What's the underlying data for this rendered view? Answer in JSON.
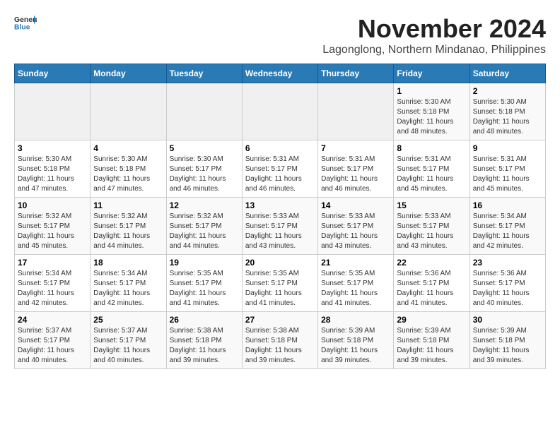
{
  "header": {
    "logo_general": "General",
    "logo_blue": "Blue",
    "month_year": "November 2024",
    "location": "Lagonglong, Northern Mindanao, Philippines"
  },
  "weekdays": [
    "Sunday",
    "Monday",
    "Tuesday",
    "Wednesday",
    "Thursday",
    "Friday",
    "Saturday"
  ],
  "weeks": [
    [
      {
        "day": "",
        "info": ""
      },
      {
        "day": "",
        "info": ""
      },
      {
        "day": "",
        "info": ""
      },
      {
        "day": "",
        "info": ""
      },
      {
        "day": "",
        "info": ""
      },
      {
        "day": "1",
        "info": "Sunrise: 5:30 AM\nSunset: 5:18 PM\nDaylight: 11 hours\nand 48 minutes."
      },
      {
        "day": "2",
        "info": "Sunrise: 5:30 AM\nSunset: 5:18 PM\nDaylight: 11 hours\nand 48 minutes."
      }
    ],
    [
      {
        "day": "3",
        "info": "Sunrise: 5:30 AM\nSunset: 5:18 PM\nDaylight: 11 hours\nand 47 minutes."
      },
      {
        "day": "4",
        "info": "Sunrise: 5:30 AM\nSunset: 5:18 PM\nDaylight: 11 hours\nand 47 minutes."
      },
      {
        "day": "5",
        "info": "Sunrise: 5:30 AM\nSunset: 5:17 PM\nDaylight: 11 hours\nand 46 minutes."
      },
      {
        "day": "6",
        "info": "Sunrise: 5:31 AM\nSunset: 5:17 PM\nDaylight: 11 hours\nand 46 minutes."
      },
      {
        "day": "7",
        "info": "Sunrise: 5:31 AM\nSunset: 5:17 PM\nDaylight: 11 hours\nand 46 minutes."
      },
      {
        "day": "8",
        "info": "Sunrise: 5:31 AM\nSunset: 5:17 PM\nDaylight: 11 hours\nand 45 minutes."
      },
      {
        "day": "9",
        "info": "Sunrise: 5:31 AM\nSunset: 5:17 PM\nDaylight: 11 hours\nand 45 minutes."
      }
    ],
    [
      {
        "day": "10",
        "info": "Sunrise: 5:32 AM\nSunset: 5:17 PM\nDaylight: 11 hours\nand 45 minutes."
      },
      {
        "day": "11",
        "info": "Sunrise: 5:32 AM\nSunset: 5:17 PM\nDaylight: 11 hours\nand 44 minutes."
      },
      {
        "day": "12",
        "info": "Sunrise: 5:32 AM\nSunset: 5:17 PM\nDaylight: 11 hours\nand 44 minutes."
      },
      {
        "day": "13",
        "info": "Sunrise: 5:33 AM\nSunset: 5:17 PM\nDaylight: 11 hours\nand 43 minutes."
      },
      {
        "day": "14",
        "info": "Sunrise: 5:33 AM\nSunset: 5:17 PM\nDaylight: 11 hours\nand 43 minutes."
      },
      {
        "day": "15",
        "info": "Sunrise: 5:33 AM\nSunset: 5:17 PM\nDaylight: 11 hours\nand 43 minutes."
      },
      {
        "day": "16",
        "info": "Sunrise: 5:34 AM\nSunset: 5:17 PM\nDaylight: 11 hours\nand 42 minutes."
      }
    ],
    [
      {
        "day": "17",
        "info": "Sunrise: 5:34 AM\nSunset: 5:17 PM\nDaylight: 11 hours\nand 42 minutes."
      },
      {
        "day": "18",
        "info": "Sunrise: 5:34 AM\nSunset: 5:17 PM\nDaylight: 11 hours\nand 42 minutes."
      },
      {
        "day": "19",
        "info": "Sunrise: 5:35 AM\nSunset: 5:17 PM\nDaylight: 11 hours\nand 41 minutes."
      },
      {
        "day": "20",
        "info": "Sunrise: 5:35 AM\nSunset: 5:17 PM\nDaylight: 11 hours\nand 41 minutes."
      },
      {
        "day": "21",
        "info": "Sunrise: 5:35 AM\nSunset: 5:17 PM\nDaylight: 11 hours\nand 41 minutes."
      },
      {
        "day": "22",
        "info": "Sunrise: 5:36 AM\nSunset: 5:17 PM\nDaylight: 11 hours\nand 41 minutes."
      },
      {
        "day": "23",
        "info": "Sunrise: 5:36 AM\nSunset: 5:17 PM\nDaylight: 11 hours\nand 40 minutes."
      }
    ],
    [
      {
        "day": "24",
        "info": "Sunrise: 5:37 AM\nSunset: 5:17 PM\nDaylight: 11 hours\nand 40 minutes."
      },
      {
        "day": "25",
        "info": "Sunrise: 5:37 AM\nSunset: 5:17 PM\nDaylight: 11 hours\nand 40 minutes."
      },
      {
        "day": "26",
        "info": "Sunrise: 5:38 AM\nSunset: 5:18 PM\nDaylight: 11 hours\nand 39 minutes."
      },
      {
        "day": "27",
        "info": "Sunrise: 5:38 AM\nSunset: 5:18 PM\nDaylight: 11 hours\nand 39 minutes."
      },
      {
        "day": "28",
        "info": "Sunrise: 5:39 AM\nSunset: 5:18 PM\nDaylight: 11 hours\nand 39 minutes."
      },
      {
        "day": "29",
        "info": "Sunrise: 5:39 AM\nSunset: 5:18 PM\nDaylight: 11 hours\nand 39 minutes."
      },
      {
        "day": "30",
        "info": "Sunrise: 5:39 AM\nSunset: 5:18 PM\nDaylight: 11 hours\nand 39 minutes."
      }
    ]
  ]
}
